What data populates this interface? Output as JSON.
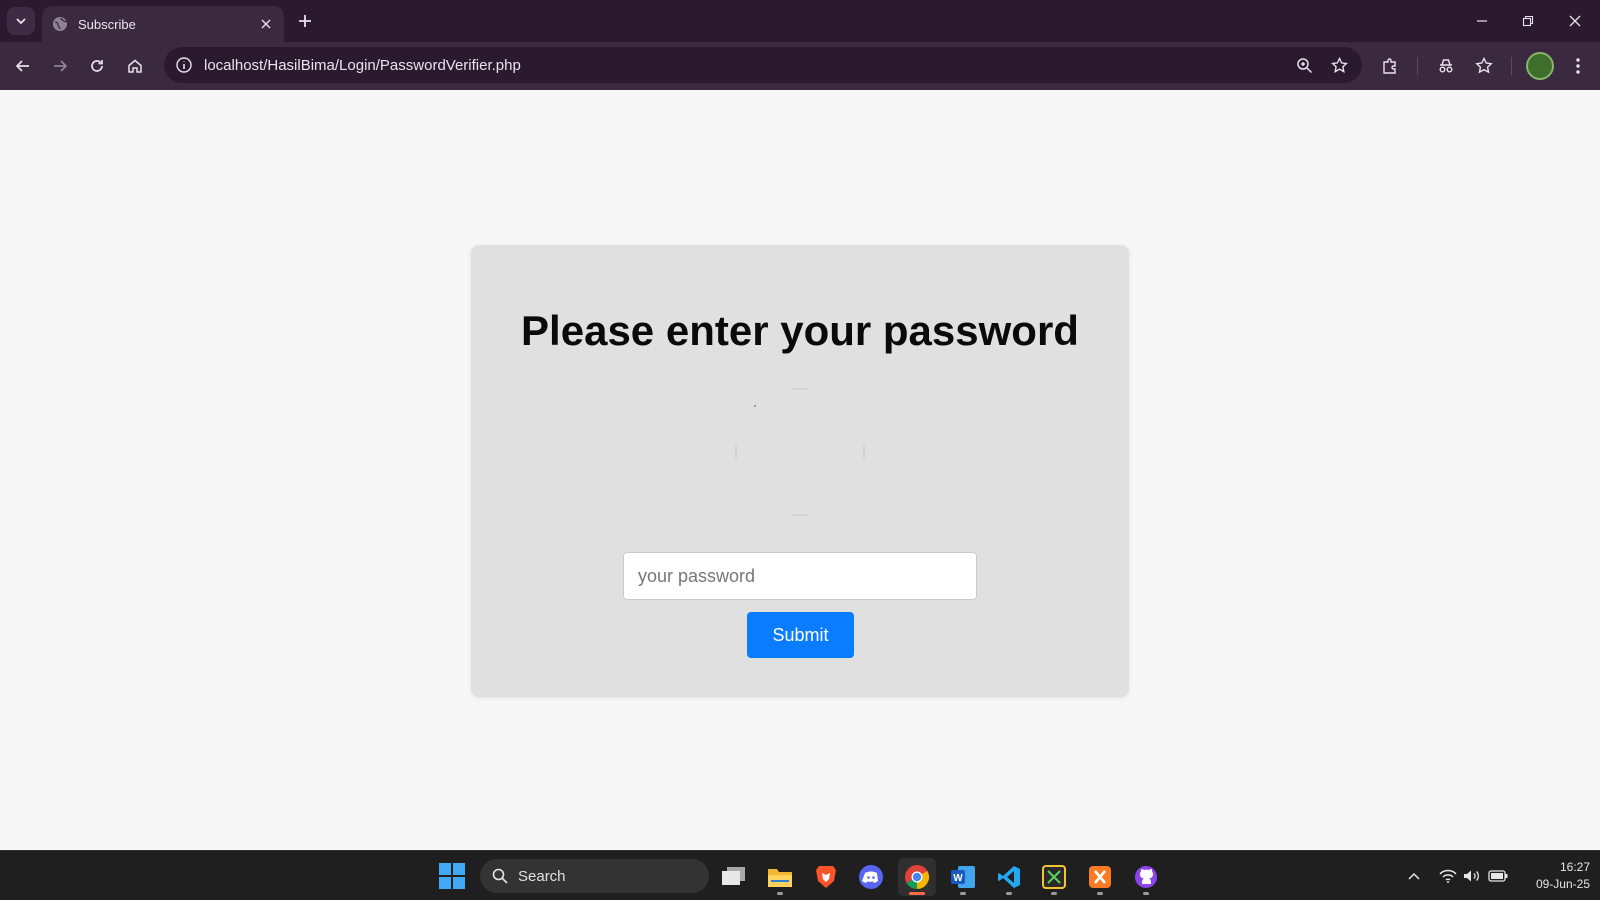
{
  "browser": {
    "tab": {
      "title": "Subscribe"
    },
    "address_bar": {
      "url": "localhost/HasilBima/Login/PasswordVerifier.php"
    }
  },
  "page": {
    "title": "Please enter your password",
    "password_input": {
      "placeholder": "your password",
      "value": ""
    },
    "submit_label": "Submit"
  },
  "taskbar": {
    "search_label": "Search",
    "apps": [
      "task-view",
      "file-explorer",
      "brave",
      "discord",
      "chrome",
      "word",
      "vscode",
      "snipping-tool",
      "xampp",
      "github-desktop"
    ],
    "clock": {
      "time": "16:27",
      "date": "09-Jun-25"
    }
  },
  "colors": {
    "titlebar": "#2b1a2f",
    "toolbar": "#3b2940",
    "page_bg": "#f7f7f7",
    "card_bg": "#e0e0e0",
    "accent_button": "#0a7cff",
    "taskbar": "#1f1f1f"
  }
}
